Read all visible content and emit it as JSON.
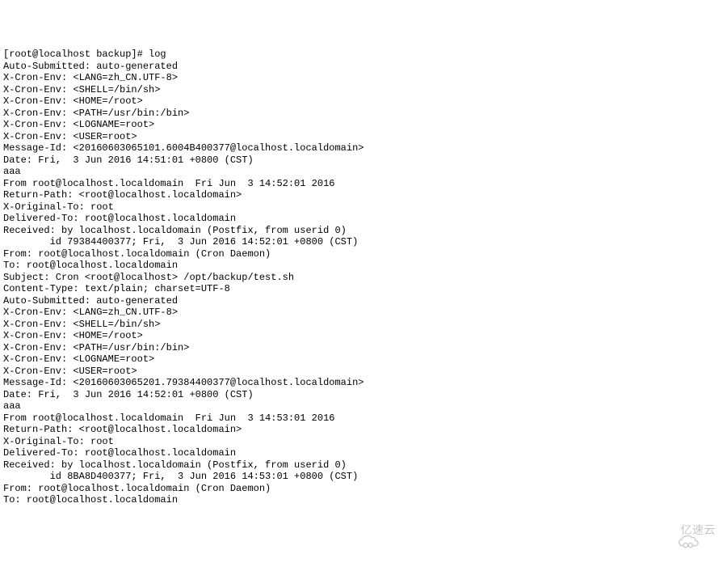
{
  "terminal": {
    "lines": [
      "[root@localhost backup]# log",
      "",
      "Auto-Submitted: auto-generated",
      "X-Cron-Env: <LANG=zh_CN.UTF-8>",
      "X-Cron-Env: <SHELL=/bin/sh>",
      "X-Cron-Env: <HOME=/root>",
      "X-Cron-Env: <PATH=/usr/bin:/bin>",
      "X-Cron-Env: <LOGNAME=root>",
      "X-Cron-Env: <USER=root>",
      "Message-Id: <20160603065101.6004B400377@localhost.localdomain>",
      "Date: Fri,  3 Jun 2016 14:51:01 +0800 (CST)",
      "",
      "aaa",
      "",
      "From root@localhost.localdomain  Fri Jun  3 14:52:01 2016",
      "Return-Path: <root@localhost.localdomain>",
      "X-Original-To: root",
      "Delivered-To: root@localhost.localdomain",
      "Received: by localhost.localdomain (Postfix, from userid 0)",
      "        id 79384400377; Fri,  3 Jun 2016 14:52:01 +0800 (CST)",
      "From: root@localhost.localdomain (Cron Daemon)",
      "To: root@localhost.localdomain",
      "Subject: Cron <root@localhost> /opt/backup/test.sh",
      "Content-Type: text/plain; charset=UTF-8",
      "Auto-Submitted: auto-generated",
      "X-Cron-Env: <LANG=zh_CN.UTF-8>",
      "X-Cron-Env: <SHELL=/bin/sh>",
      "X-Cron-Env: <HOME=/root>",
      "X-Cron-Env: <PATH=/usr/bin:/bin>",
      "X-Cron-Env: <LOGNAME=root>",
      "X-Cron-Env: <USER=root>",
      "Message-Id: <20160603065201.79384400377@localhost.localdomain>",
      "Date: Fri,  3 Jun 2016 14:52:01 +0800 (CST)",
      "",
      "aaa",
      "",
      "From root@localhost.localdomain  Fri Jun  3 14:53:01 2016",
      "Return-Path: <root@localhost.localdomain>",
      "X-Original-To: root",
      "Delivered-To: root@localhost.localdomain",
      "Received: by localhost.localdomain (Postfix, from userid 0)",
      "        id 8BA8D400377; Fri,  3 Jun 2016 14:53:01 +0800 (CST)",
      "From: root@localhost.localdomain (Cron Daemon)",
      "To: root@localhost.localdomain"
    ]
  },
  "watermark": {
    "text": "亿速云"
  }
}
